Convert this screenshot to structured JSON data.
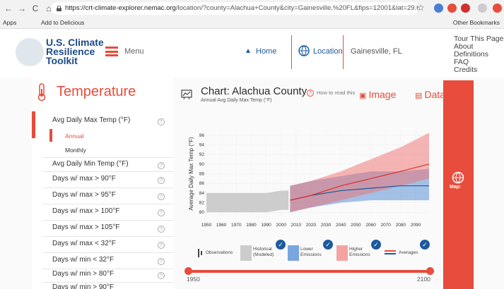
{
  "browser": {
    "url": "https://crt-climate-explorer.nemac.org/location/?county=Alachua+County&city=Gainesville,%20FL&fips=12001&lat=29.6516344...",
    "url_host": "https://crt-climate-explorer.nemac.org",
    "url_path": "/location/?county=Alachua+County&city=Gainesville,%20FL&fips=12001&lat=29.6516344...",
    "bookmarks": [
      "Apps",
      "Add to Delicious"
    ],
    "other_bookmarks": "Other Bookmarks"
  },
  "header": {
    "logo_lines": [
      "U.S. Climate",
      "Resilience",
      "Toolkit"
    ],
    "menu_label": "Menu",
    "home_label": "Home",
    "location_label": "Location",
    "location_value": "Gainesville, FL",
    "help_links": [
      "Tour This Page",
      "About",
      "Definitions",
      "FAQ",
      "Credits"
    ]
  },
  "sidebar": {
    "title": "Temperature",
    "variables": [
      {
        "label": "Avg Daily Max Temp (°F)",
        "info": "?"
      },
      {
        "label": "Annual"
      },
      {
        "label": "Monthly"
      },
      {
        "label": "Avg Daily Min Temp (°F)",
        "info": "?"
      },
      {
        "label": "Days w/ max > 90°F",
        "info": "?"
      },
      {
        "label": "Days w/ max > 95°F",
        "info": "?"
      },
      {
        "label": "Days w/ max > 100°F",
        "info": "?"
      },
      {
        "label": "Days w/ max > 105°F",
        "info": "?"
      },
      {
        "label": "Days w/ max < 32°F",
        "info": "?"
      },
      {
        "label": "Days w/ min < 32°F",
        "info": "?"
      },
      {
        "label": "Days w/ min > 80°F",
        "info": "?"
      },
      {
        "label": "Days w/ min > 90°F",
        "info": "?"
      }
    ]
  },
  "chart_header": {
    "title": "Chart: Alachua County",
    "subtitle": "Annual Avg Daily Max Temp (°F)",
    "how_to_read": "How to read this",
    "image_label": "Image",
    "data_label": "Data"
  },
  "map_panel": {
    "label": "Map:"
  },
  "legend": {
    "observations": "Observations",
    "historical": "Historical (Modeled)",
    "lower": "Lower Emissions",
    "higher": "Higher Emissions",
    "averages": "Averages"
  },
  "slider": {
    "start": "1950",
    "end": "2100"
  },
  "colors": {
    "accent": "#e74c3c",
    "brand_blue": "#1c4a88",
    "historical": "#cccccc",
    "lower": "#5b8fd6",
    "higher": "#f08585"
  },
  "chart_data": {
    "type": "area",
    "title": "",
    "xlabel": "",
    "ylabel": "Average Daily Max Temp (°F)",
    "xlim": [
      1950,
      2099
    ],
    "ylim": [
      79,
      97
    ],
    "xticks": [
      1950,
      1960,
      1970,
      1980,
      1990,
      2000,
      2010,
      2020,
      2030,
      2040,
      2050,
      2060,
      2070,
      2080,
      2090
    ],
    "yticks": [
      80,
      82,
      84,
      86,
      88,
      90,
      92,
      94,
      96
    ],
    "series": [
      {
        "name": "Historical (Modeled)",
        "x": [
          1950,
          1960,
          1970,
          1980,
          1990,
          2000,
          2005
        ],
        "low": [
          80,
          80,
          80,
          80,
          80,
          80.5,
          80.5
        ],
        "high": [
          84,
          84,
          84,
          84,
          84,
          84.5,
          84.5
        ]
      },
      {
        "name": "Lower Emissions",
        "x": [
          2006,
          2020,
          2040,
          2060,
          2080,
          2099
        ],
        "low": [
          80,
          81,
          82,
          82.5,
          82.5,
          82.5
        ],
        "high": [
          85.5,
          86.5,
          87.5,
          88.5,
          88.5,
          89
        ],
        "avg": [
          82.5,
          83.5,
          84.5,
          85,
          85.5,
          85.5
        ]
      },
      {
        "name": "Higher Emissions",
        "x": [
          2006,
          2020,
          2040,
          2060,
          2080,
          2099
        ],
        "low": [
          80,
          81,
          82.5,
          84,
          85.5,
          87
        ],
        "high": [
          85.5,
          86.5,
          88.5,
          91,
          93.5,
          96.5
        ],
        "avg": [
          82.5,
          83.5,
          85.5,
          87,
          88.5,
          90
        ]
      }
    ]
  }
}
